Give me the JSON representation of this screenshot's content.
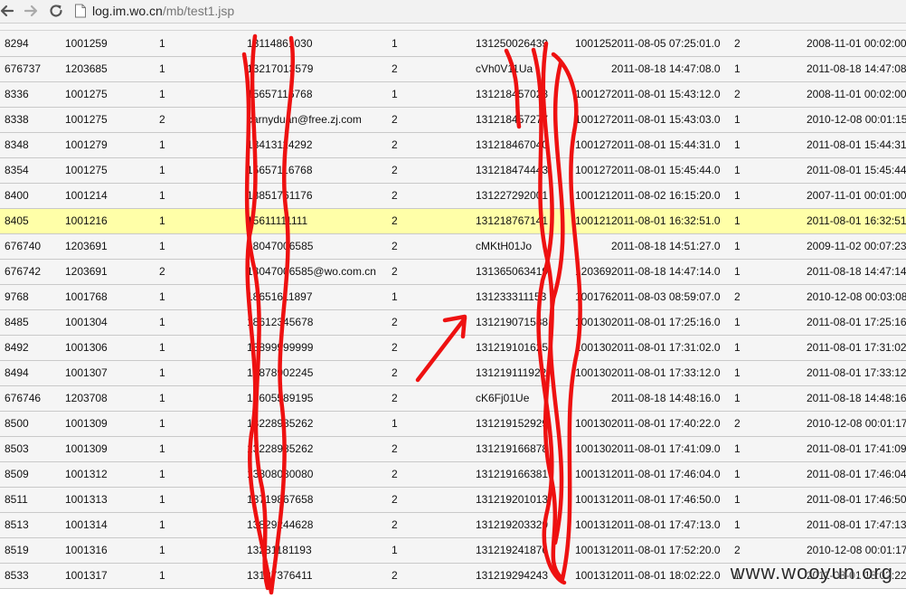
{
  "browser": {
    "url_host": "log.im.wo.cn",
    "url_path": "/mb/test1.jsp"
  },
  "table": {
    "rows": [
      {
        "c": [
          "8294",
          "1001259",
          "1",
          "13114861030",
          "1",
          "131250026439",
          "1001259",
          "2011-08-05 07:25:01.0",
          "2",
          "2008-11-01 00:02:00"
        ]
      },
      {
        "c": [
          "676737",
          "1203685",
          "1",
          "13217013579",
          "2",
          "cVh0V11Ua",
          "",
          "2011-08-18 14:47:08.0",
          "1",
          "2011-08-18 14:47:08"
        ]
      },
      {
        "c": [
          "8336",
          "1001275",
          "1",
          "15657116768",
          "1",
          "131218457028",
          "1001275",
          "2011-08-01 15:43:12.0",
          "2",
          "2008-11-01 00:02:00"
        ]
      },
      {
        "c": [
          "8338",
          "1001275",
          "2",
          "carnyduan@free.zj.com",
          "2",
          "131218457277",
          "1001275",
          "2011-08-01 15:43:03.0",
          "1",
          "2010-12-08 00:01:15"
        ]
      },
      {
        "c": [
          "8348",
          "1001279",
          "1",
          "13413114292",
          "2",
          "131218467040",
          "1001279",
          "2011-08-01 15:44:31.0",
          "1",
          "2011-08-01 15:44:31"
        ]
      },
      {
        "c": [
          "8354",
          "1001275",
          "1",
          "15657116768",
          "2",
          "131218474443",
          "1001275",
          "2011-08-01 15:45:44.0",
          "1",
          "2011-08-01 15:45:44"
        ]
      },
      {
        "c": [
          "8400",
          "1001214",
          "1",
          "18851761176",
          "2",
          "131227292001",
          "1001214",
          "2011-08-02 16:15:20.0",
          "1",
          "2007-11-01 00:01:00"
        ]
      },
      {
        "c": [
          "8405",
          "1001216",
          "1",
          "15611111111",
          "2",
          "131218767141",
          "1001216",
          "2011-08-01 16:32:51.0",
          "1",
          "2011-08-01 16:32:51"
        ],
        "highlight": true
      },
      {
        "c": [
          "676740",
          "1203691",
          "1",
          "18047006585",
          "2",
          "cMKtH01Jo",
          "",
          "2011-08-18 14:51:27.0",
          "1",
          "2009-11-02 00:07:23"
        ]
      },
      {
        "c": [
          "676742",
          "1203691",
          "2",
          "18047006585@wo.com.cn",
          "2",
          "131365063419",
          "1203691",
          "2011-08-18 14:47:14.0",
          "1",
          "2011-08-18 14:47:14"
        ]
      },
      {
        "c": [
          "9768",
          "1001768",
          "1",
          "18651611897",
          "1",
          "131233311153",
          "1001768",
          "2011-08-03 08:59:07.0",
          "2",
          "2010-12-08 00:03:08"
        ]
      },
      {
        "c": [
          "8485",
          "1001304",
          "1",
          "18612345678",
          "2",
          "131219071588",
          "1001304",
          "2011-08-01 17:25:16.0",
          "1",
          "2011-08-01 17:25:16"
        ]
      },
      {
        "c": [
          "8492",
          "1001306",
          "1",
          "13899999999",
          "2",
          "131219101625",
          "1001306",
          "2011-08-01 17:31:02.0",
          "1",
          "2011-08-01 17:31:02"
        ]
      },
      {
        "c": [
          "8494",
          "1001307",
          "1",
          "13878902245",
          "2",
          "131219111922",
          "1001307",
          "2011-08-01 17:33:12.0",
          "1",
          "2011-08-01 17:33:12"
        ]
      },
      {
        "c": [
          "676746",
          "1203708",
          "1",
          "18605589195",
          "2",
          "cK6Fj01Ue",
          "",
          "2011-08-18 14:48:16.0",
          "1",
          "2011-08-18 14:48:16"
        ]
      },
      {
        "c": [
          "8500",
          "1001309",
          "1",
          "13228985262",
          "1",
          "131219152929",
          "1001309",
          "2011-08-01 17:40:22.0",
          "2",
          "2010-12-08 00:01:17"
        ]
      },
      {
        "c": [
          "8503",
          "1001309",
          "1",
          "13228985262",
          "2",
          "131219166878",
          "1001309",
          "2011-08-01 17:41:09.0",
          "1",
          "2011-08-01 17:41:09"
        ]
      },
      {
        "c": [
          "8509",
          "1001312",
          "1",
          "13808080080",
          "2",
          "131219166381",
          "1001312",
          "2011-08-01 17:46:04.0",
          "1",
          "2011-08-01 17:46:04"
        ]
      },
      {
        "c": [
          "8511",
          "1001313",
          "1",
          "13719867658",
          "2",
          "131219201013",
          "1001313",
          "2011-08-01 17:46:50.0",
          "1",
          "2011-08-01 17:46:50"
        ]
      },
      {
        "c": [
          "8513",
          "1001314",
          "1",
          "13829244628",
          "2",
          "131219203329",
          "1001314",
          "2011-08-01 17:47:13.0",
          "1",
          "2011-08-01 17:47:13"
        ]
      },
      {
        "c": [
          "8519",
          "1001316",
          "1",
          "13281181193",
          "1",
          "131219241876",
          "1001316",
          "2011-08-01 17:52:20.0",
          "2",
          "2010-12-08 00:01:17"
        ]
      },
      {
        "c": [
          "8533",
          "1001317",
          "1",
          "13187376411",
          "2",
          "131219294243",
          "1001317",
          "2011-08-01 18:02:22.0",
          "1",
          "2011-08-01 18:02:22"
        ]
      }
    ]
  },
  "watermark": "www.wooyun.org",
  "colors": {
    "highlight_row": "#ffffa8",
    "scribble": "#ee1111"
  }
}
